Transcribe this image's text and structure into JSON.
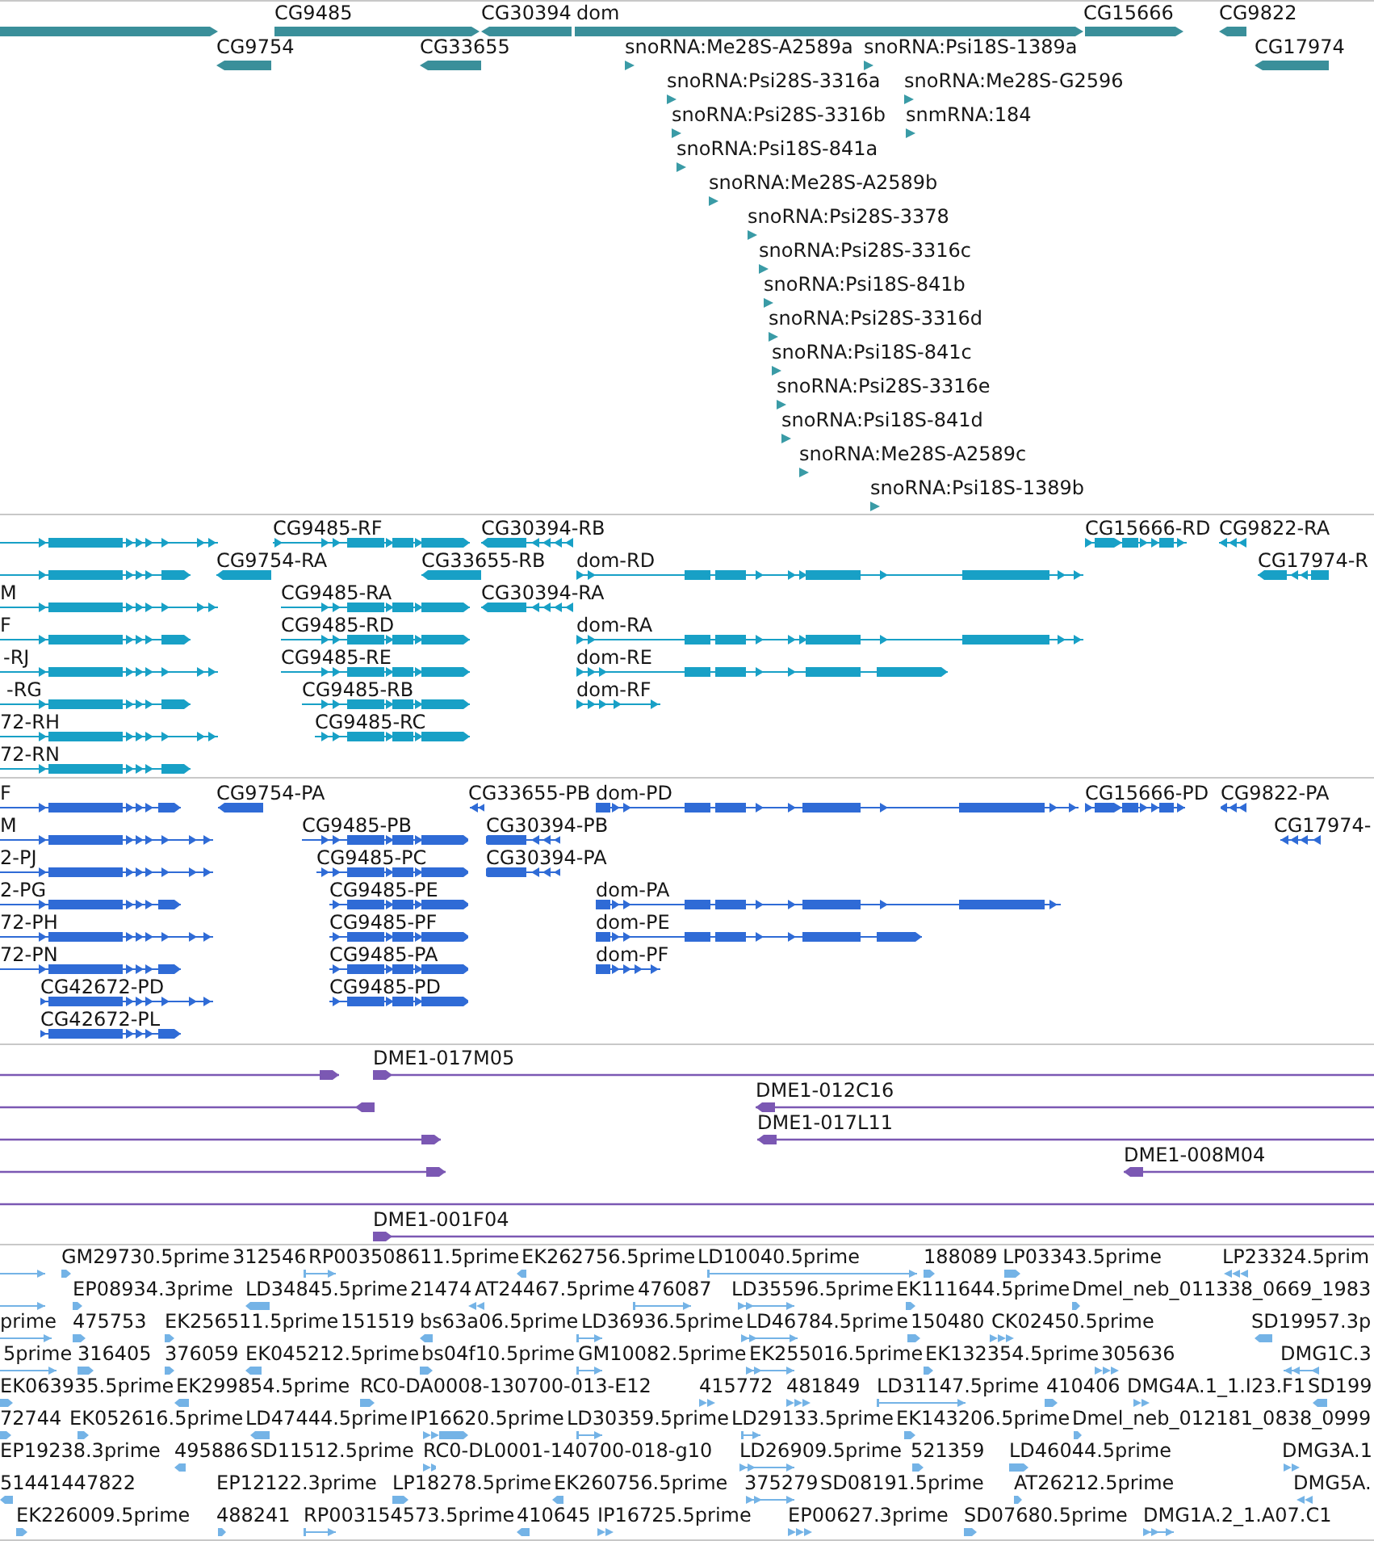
{
  "tracks": [
    {
      "kind": "gene",
      "lanes": [
        {
          "features": [
            {
              "kind": "gene",
              "reverse": false
            },
            {
              "kind": "gene",
              "label": "CG9485",
              "reverse": false
            },
            {
              "kind": "gene",
              "label": "CG30394",
              "reverse": true
            },
            {
              "kind": "gene",
              "label": "dom",
              "reverse": false
            },
            {
              "kind": "gene",
              "label": "CG15666",
              "reverse": false
            },
            {
              "kind": "gene",
              "label": "CG9822",
              "reverse": true
            }
          ]
        },
        {
          "features": [
            {
              "kind": "gene",
              "label": "CG9754",
              "reverse": true
            },
            {
              "kind": "gene",
              "label": "CG33655",
              "reverse": true
            },
            {
              "kind": "rna",
              "label": "snoRNA:Me28S-A2589a",
              "reverse": false
            },
            {
              "kind": "rna",
              "label": "snoRNA:Psi18S-1389a",
              "reverse": false
            },
            {
              "kind": "gene",
              "label": "CG17974",
              "reverse": true
            }
          ]
        },
        {
          "features": [
            {
              "kind": "rna",
              "label": "snoRNA:Psi28S-3316a",
              "reverse": false
            },
            {
              "kind": "rna",
              "label": "snoRNA:Me28S-G2596",
              "reverse": false
            }
          ]
        },
        {
          "features": [
            {
              "kind": "rna",
              "label": "snoRNA:Psi28S-3316b",
              "reverse": false
            },
            {
              "kind": "rna",
              "label": "snmRNA:184",
              "reverse": false
            }
          ]
        },
        {
          "features": [
            {
              "kind": "rna",
              "label": "snoRNA:Psi18S-841a",
              "reverse": false
            }
          ]
        },
        {
          "features": [
            {
              "kind": "rna",
              "label": "snoRNA:Me28S-A2589b",
              "reverse": false
            }
          ]
        },
        {
          "features": [
            {
              "kind": "rna",
              "label": "snoRNA:Psi28S-3378",
              "reverse": false
            }
          ]
        },
        {
          "features": [
            {
              "kind": "rna",
              "label": "snoRNA:Psi28S-3316c",
              "reverse": false
            }
          ]
        },
        {
          "features": [
            {
              "kind": "rna",
              "label": "snoRNA:Psi18S-841b",
              "reverse": false
            }
          ]
        },
        {
          "features": [
            {
              "kind": "rna",
              "label": "snoRNA:Psi28S-3316d",
              "reverse": false
            }
          ]
        },
        {
          "features": [
            {
              "kind": "rna",
              "label": "snoRNA:Psi18S-841c",
              "reverse": false
            }
          ]
        },
        {
          "features": [
            {
              "kind": "rna",
              "label": "snoRNA:Psi28S-3316e",
              "reverse": false
            }
          ]
        },
        {
          "features": [
            {
              "kind": "rna",
              "label": "snoRNA:Psi18S-841d",
              "reverse": false
            }
          ]
        },
        {
          "features": [
            {
              "kind": "rna",
              "label": "snoRNA:Me28S-A2589c",
              "reverse": false
            }
          ]
        },
        {
          "features": [
            {
              "kind": "rna",
              "label": "snoRNA:Psi18S-1389b",
              "reverse": false
            }
          ]
        }
      ]
    },
    {
      "kind": "mrna",
      "lanes": [
        {
          "features": [
            {
              "reverse": false
            },
            {
              "label": "CG9485-RF",
              "reverse": false
            },
            {
              "label": "CG30394-RB",
              "reverse": true
            },
            {
              "label": "CG15666-RD",
              "reverse": false
            },
            {
              "label": "CG9822-RA",
              "reverse": true
            }
          ]
        },
        {
          "features": [
            {
              "reverse": false
            },
            {
              "label": "CG9754-RA",
              "reverse": true
            },
            {
              "label": "CG33655-RB",
              "reverse": true
            },
            {
              "label": "dom-RD",
              "reverse": false
            },
            {
              "label": "CG17974-R",
              "reverse": true
            }
          ]
        },
        {
          "features": [
            {
              "label": "M",
              "reverse": false
            },
            {
              "label": "CG9485-RA",
              "reverse": false
            },
            {
              "label": "CG30394-RA",
              "reverse": true
            }
          ]
        },
        {
          "features": [
            {
              "label": "F",
              "reverse": false
            },
            {
              "label": "CG9485-RD",
              "reverse": false
            },
            {
              "label": "dom-RA",
              "reverse": false
            }
          ]
        },
        {
          "features": [
            {
              "label": "-RJ",
              "reverse": false
            },
            {
              "label": "CG9485-RE",
              "reverse": false
            },
            {
              "label": "dom-RE",
              "reverse": false
            }
          ]
        },
        {
          "features": [
            {
              "label": "-RG",
              "reverse": false
            },
            {
              "label": "CG9485-RB",
              "reverse": false
            },
            {
              "label": "dom-RF",
              "reverse": false
            }
          ]
        },
        {
          "features": [
            {
              "label": "72-RH",
              "reverse": false
            },
            {
              "label": "CG9485-RC",
              "reverse": false
            }
          ]
        },
        {
          "features": [
            {
              "label": "72-RN",
              "reverse": false
            }
          ]
        }
      ]
    },
    {
      "kind": "protein",
      "lanes": [
        {
          "features": [
            {
              "label": "F",
              "reverse": false
            },
            {
              "label": "CG9754-PA",
              "reverse": true
            },
            {
              "label": "CG33655-PB",
              "reverse": true
            },
            {
              "label": "dom-PD",
              "reverse": false
            },
            {
              "label": "CG15666-PD",
              "reverse": false
            },
            {
              "label": "CG9822-PA",
              "reverse": true
            }
          ]
        },
        {
          "features": [
            {
              "label": "M",
              "reverse": false
            },
            {
              "label": "CG9485-PB",
              "reverse": false
            },
            {
              "label": "CG30394-PB",
              "reverse": true
            },
            {
              "label": "CG17974-",
              "reverse": true
            }
          ]
        },
        {
          "features": [
            {
              "label": "2-PJ",
              "reverse": false
            },
            {
              "label": "CG9485-PC",
              "reverse": false
            },
            {
              "label": "CG30394-PA",
              "reverse": true
            }
          ]
        },
        {
          "features": [
            {
              "label": "2-PG",
              "reverse": false
            },
            {
              "label": "CG9485-PE",
              "reverse": false
            },
            {
              "label": "dom-PA",
              "reverse": false
            }
          ]
        },
        {
          "features": [
            {
              "label": "72-PH",
              "reverse": false
            },
            {
              "label": "CG9485-PF",
              "reverse": false
            },
            {
              "label": "dom-PE",
              "reverse": false
            }
          ]
        },
        {
          "features": [
            {
              "label": "72-PN",
              "reverse": false
            },
            {
              "label": "CG9485-PA",
              "reverse": false
            },
            {
              "label": "dom-PF",
              "reverse": false
            }
          ]
        },
        {
          "features": [
            {
              "label": "CG42672-PD",
              "reverse": false
            },
            {
              "label": "CG9485-PD",
              "reverse": false
            }
          ]
        },
        {
          "features": [
            {
              "label": "CG42672-PL",
              "reverse": false
            }
          ]
        }
      ]
    },
    {
      "kind": "clone",
      "lanes": [
        {
          "features": [
            {
              "head": true,
              "reverse": false
            },
            {
              "label": "DME1-017M05",
              "head": true,
              "reverse": false
            }
          ]
        },
        {
          "features": [
            {
              "head": true,
              "reverse": true
            },
            {
              "label": "DME1-012C16",
              "head": true,
              "reverse": true
            }
          ]
        },
        {
          "features": [
            {
              "head": true,
              "reverse": false
            },
            {
              "label": "DME1-017L11",
              "head": true,
              "reverse": true
            }
          ]
        },
        {
          "features": [
            {
              "head": true,
              "reverse": false
            },
            {
              "label": "DME1-008M04",
              "head": true,
              "reverse": true
            }
          ]
        },
        {
          "features": [
            {
              "head": false
            }
          ]
        },
        {
          "features": [
            {
              "label": "DME1-001F04",
              "head": true,
              "reverse": false
            }
          ]
        }
      ]
    },
    {
      "kind": "est",
      "lanes": [
        {
          "features": [
            {
              "reverse": false
            },
            {
              "label": "GM29730.5prime",
              "reverse": false
            },
            {
              "label": "312546"
            },
            {
              "label": "RP003508611.5prime",
              "reverse": false
            },
            {
              "label": "EK262756.5prime",
              "reverse": true
            },
            {
              "label": "LD10040.5prime",
              "reverse": false
            },
            {
              "label": "188089",
              "reverse": false
            },
            {
              "label": "LP03343.5prime",
              "reverse": false
            },
            {
              "label": "LP23324.5prim",
              "reverse": true
            }
          ]
        },
        {
          "features": [
            {
              "reverse": false
            },
            {
              "label": "EP08934.3prime",
              "reverse": false
            },
            {
              "label": "LD34845.5prime",
              "reverse": true
            },
            {
              "label": "21474"
            },
            {
              "label": "AT24467.5prime",
              "reverse": true
            },
            {
              "label": "476087",
              "reverse": false
            },
            {
              "label": "LD35596.5prime",
              "reverse": false
            },
            {
              "label": "EK111644.5prime",
              "reverse": false
            },
            {
              "label": "Dmel_neb_011338_0669_1983",
              "reverse": false
            }
          ]
        },
        {
          "features": [
            {
              "label": "prime",
              "reverse": false
            },
            {
              "label": "475753",
              "reverse": false
            },
            {
              "label": "EK256511.5prime",
              "reverse": false
            },
            {
              "label": "151519"
            },
            {
              "label": "bs63a06.5prime",
              "reverse": true
            },
            {
              "label": "LD36936.5prime",
              "reverse": false
            },
            {
              "label": "LD46784.5prime",
              "reverse": false
            },
            {
              "label": "150480",
              "reverse": false
            },
            {
              "label": "CK02450.5prime",
              "reverse": false
            },
            {
              "label": "SD19957.3p",
              "reverse": true
            }
          ]
        },
        {
          "features": [
            {
              "label": "5prime",
              "reverse": false
            },
            {
              "label": "316405",
              "reverse": false
            },
            {
              "label": "376059",
              "reverse": false
            },
            {
              "label": "EK045212.5prime",
              "reverse": true
            },
            {
              "label": "bs04f10.5prime",
              "reverse": false
            },
            {
              "label": "GM10082.5prime",
              "reverse": false
            },
            {
              "label": "EK255016.5prime",
              "reverse": false
            },
            {
              "label": "EK132354.5prime",
              "reverse": false
            },
            {
              "label": "305636",
              "reverse": false
            },
            {
              "label": "DMG1C.3",
              "reverse": true
            }
          ]
        },
        {
          "features": [
            {
              "label": "EK063935.5prime",
              "reverse": false
            },
            {
              "label": "EK299854.5prime",
              "reverse": true
            },
            {
              "label": "RC0-DA0008-130700-013-E12",
              "reverse": false
            },
            {
              "label": "415772",
              "reverse": false
            },
            {
              "label": "481849",
              "reverse": false
            },
            {
              "label": "LD31147.5prime",
              "reverse": false
            },
            {
              "label": "410406",
              "reverse": false
            },
            {
              "label": "DMG4A.1_1.I23.F1",
              "reverse": false
            },
            {
              "label": "SD199",
              "reverse": true
            }
          ]
        },
        {
          "features": [
            {
              "label": "72744",
              "reverse": false
            },
            {
              "label": "EK052616.5prime",
              "reverse": false
            },
            {
              "label": "LD47444.5prime",
              "reverse": true
            },
            {
              "label": "IP16620.5prime",
              "reverse": false
            },
            {
              "label": "LD30359.5prime",
              "reverse": false
            },
            {
              "label": "LD29133.5prime",
              "reverse": false
            },
            {
              "label": "EK143206.5prime",
              "reverse": false
            },
            {
              "label": "Dmel_neb_012181_0838_0999",
              "reverse": false
            }
          ]
        },
        {
          "features": [
            {
              "label": "EP19238.3prime"
            },
            {
              "label": "495886",
              "reverse": true
            },
            {
              "label": "SD11512.5prime"
            },
            {
              "label": "RC0-DL0001-140700-018-g10",
              "reverse": false
            },
            {
              "label": "LD26909.5prime",
              "reverse": false
            },
            {
              "label": "521359",
              "reverse": false
            },
            {
              "label": "LD46044.5prime",
              "reverse": false
            },
            {
              "label": "DMG3A.1",
              "reverse": false
            }
          ]
        },
        {
          "features": [
            {
              "label": "51441447822",
              "reverse": true
            },
            {
              "label": "EP12122.3prime"
            },
            {
              "label": "LP18278.5prime",
              "reverse": false
            },
            {
              "label": "EK260756.5prime",
              "reverse": true
            },
            {
              "label": "375279",
              "reverse": false
            },
            {
              "label": "SD08191.5prime"
            },
            {
              "label": "AT26212.5prime",
              "reverse": false
            },
            {
              "label": "DMG5A.",
              "reverse": true
            }
          ]
        },
        {
          "features": [
            {
              "label": "EK226009.5prime",
              "reverse": false
            },
            {
              "label": "488241",
              "reverse": false
            },
            {
              "label": "RP003154573.5prime",
              "reverse": false
            },
            {
              "label": "410645",
              "reverse": true
            },
            {
              "label": "IP16725.5prime",
              "reverse": false
            },
            {
              "label": "EP00627.3prime",
              "reverse": false
            },
            {
              "label": "SD07680.5prime",
              "reverse": false
            },
            {
              "label": "DMG1A.2_1.A07.C1",
              "reverse": false
            }
          ]
        }
      ]
    }
  ]
}
